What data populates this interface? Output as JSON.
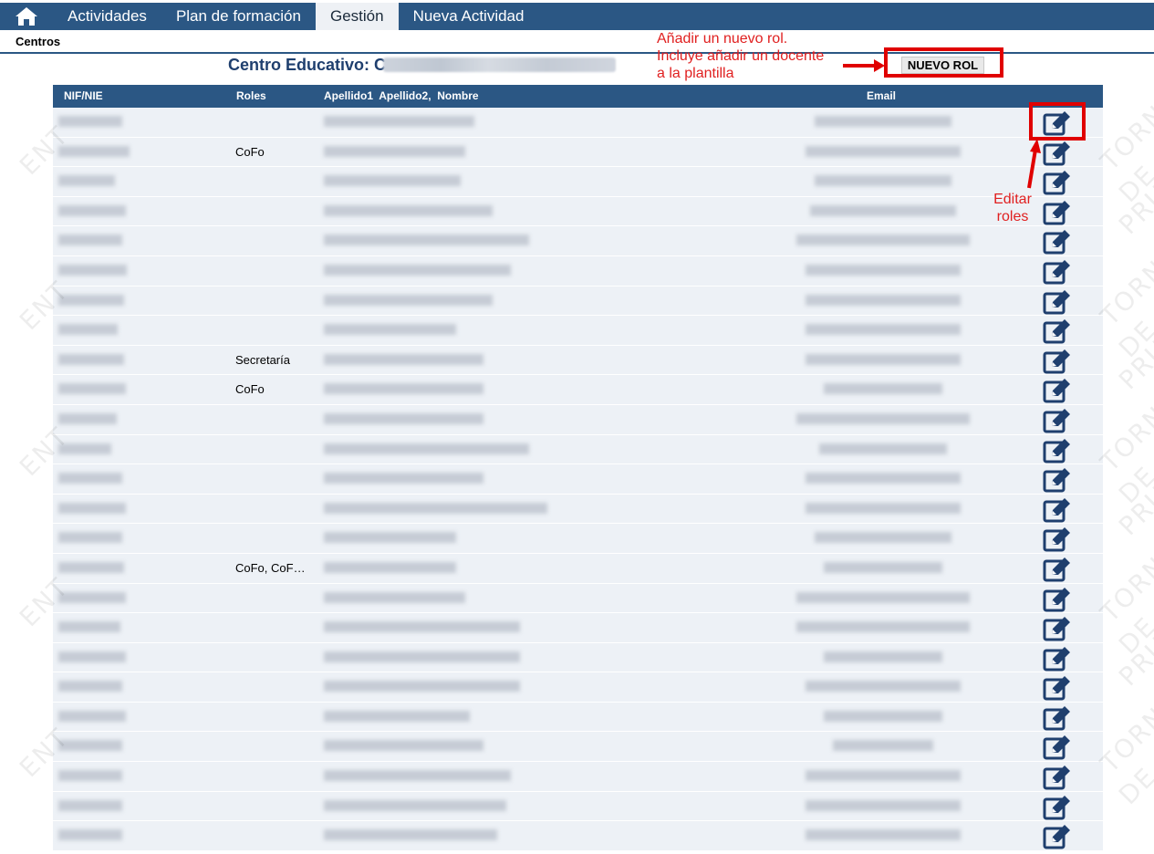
{
  "nav": {
    "home_icon": "home-icon",
    "tabs": [
      {
        "label": "Actividades",
        "active": false
      },
      {
        "label": "Plan de formación",
        "active": false
      },
      {
        "label": "Gestión",
        "active": true
      },
      {
        "label": "Nueva Actividad",
        "active": false
      }
    ]
  },
  "breadcrumb": "Centros",
  "centro": {
    "title": "Centro Educativo: C"
  },
  "actions": {
    "new_role": "NUEVO ROL"
  },
  "annotations": {
    "new_role_line1": "Añadir un nuevo rol.",
    "new_role_line2": "Incluye añadir un docente",
    "new_role_line3": "a la plantilla",
    "edit_line1": "Editar",
    "edit_line2": "roles"
  },
  "colors": {
    "nav": "#2b5784",
    "annotation": "#e02020",
    "row": "#edf1f6",
    "edit_icon": "#1f3f6e"
  },
  "table": {
    "headers": {
      "nif": "NIF/NIE",
      "roles": "Roles",
      "names": "Apellido1  Apellido2,  Nombre",
      "email": "Email"
    },
    "rows": [
      {
        "role": ""
      },
      {
        "role": "CoFo"
      },
      {
        "role": ""
      },
      {
        "role": ""
      },
      {
        "role": ""
      },
      {
        "role": ""
      },
      {
        "role": ""
      },
      {
        "role": ""
      },
      {
        "role": "Secretaría"
      },
      {
        "role": "CoFo"
      },
      {
        "role": ""
      },
      {
        "role": ""
      },
      {
        "role": ""
      },
      {
        "role": ""
      },
      {
        "role": ""
      },
      {
        "role": "CoFo, CoF…"
      },
      {
        "role": ""
      },
      {
        "role": ""
      },
      {
        "role": ""
      },
      {
        "role": ""
      },
      {
        "role": ""
      },
      {
        "role": ""
      },
      {
        "role": ""
      },
      {
        "role": ""
      },
      {
        "role": ""
      }
    ]
  }
}
